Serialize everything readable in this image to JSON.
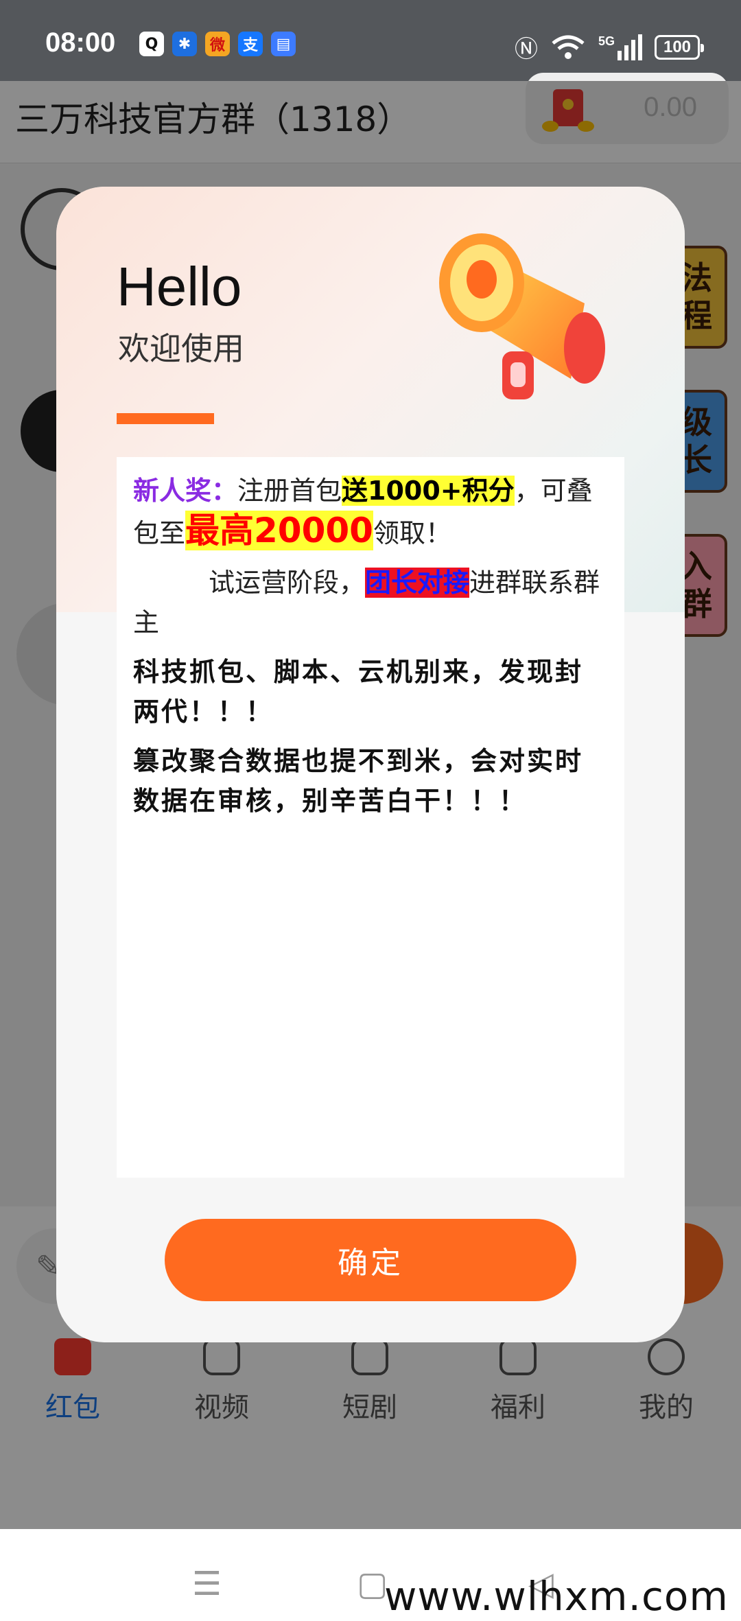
{
  "status_bar": {
    "time": "08:00",
    "apps": [
      {
        "name": "qq-icon",
        "glyph": "Q",
        "color": "#111111"
      },
      {
        "name": "pinwheel-icon",
        "glyph": "✱",
        "color": "#1e6fe0"
      },
      {
        "name": "weibo-icon",
        "glyph": "微",
        "color": "#f5a623"
      },
      {
        "name": "alipay-icon",
        "glyph": "支",
        "color": "#1677ff"
      },
      {
        "name": "doc-icon",
        "glyph": "▤",
        "color": "#3d7bff"
      }
    ],
    "signal": "5G",
    "battery": "100"
  },
  "header": {
    "title": "三万科技官方群（1318）",
    "balance": "0.00"
  },
  "side_badges": [
    {
      "top": "法",
      "bottom": "程"
    },
    {
      "top": "级",
      "bottom": "长"
    },
    {
      "top": "入",
      "bottom": "群"
    }
  ],
  "dialog": {
    "greeting": "Hello",
    "subtitle": "欢迎使用",
    "p1": {
      "label": "新人奖：",
      "text1": "注册首包",
      "highlight1": "送1000+积分",
      "text2": "，可叠包至",
      "highlight2": "最高20000",
      "text3": "领取！"
    },
    "p2": {
      "text1": "试运营阶段，",
      "highlight": "团长对接",
      "text2": "进群联系群主"
    },
    "p3": "科技抓包、脚本、云机别来，发现封两代！！！",
    "p4": "篡改聚合数据也提不到米，会对实时数据在审核，别辛苦白干！！！",
    "confirm": "确定"
  },
  "tabs": [
    {
      "label": "红包",
      "icon": "redpacket-icon",
      "active": true
    },
    {
      "label": "视频",
      "icon": "video-icon",
      "active": false
    },
    {
      "label": "短剧",
      "icon": "tv-icon",
      "active": false
    },
    {
      "label": "福利",
      "icon": "gift-icon",
      "active": false
    },
    {
      "label": "我的",
      "icon": "user-icon",
      "active": false
    }
  ],
  "nav": {
    "menu": "☰",
    "home": "▢",
    "back": "◁"
  },
  "watermark": "www.wlhxm.com"
}
